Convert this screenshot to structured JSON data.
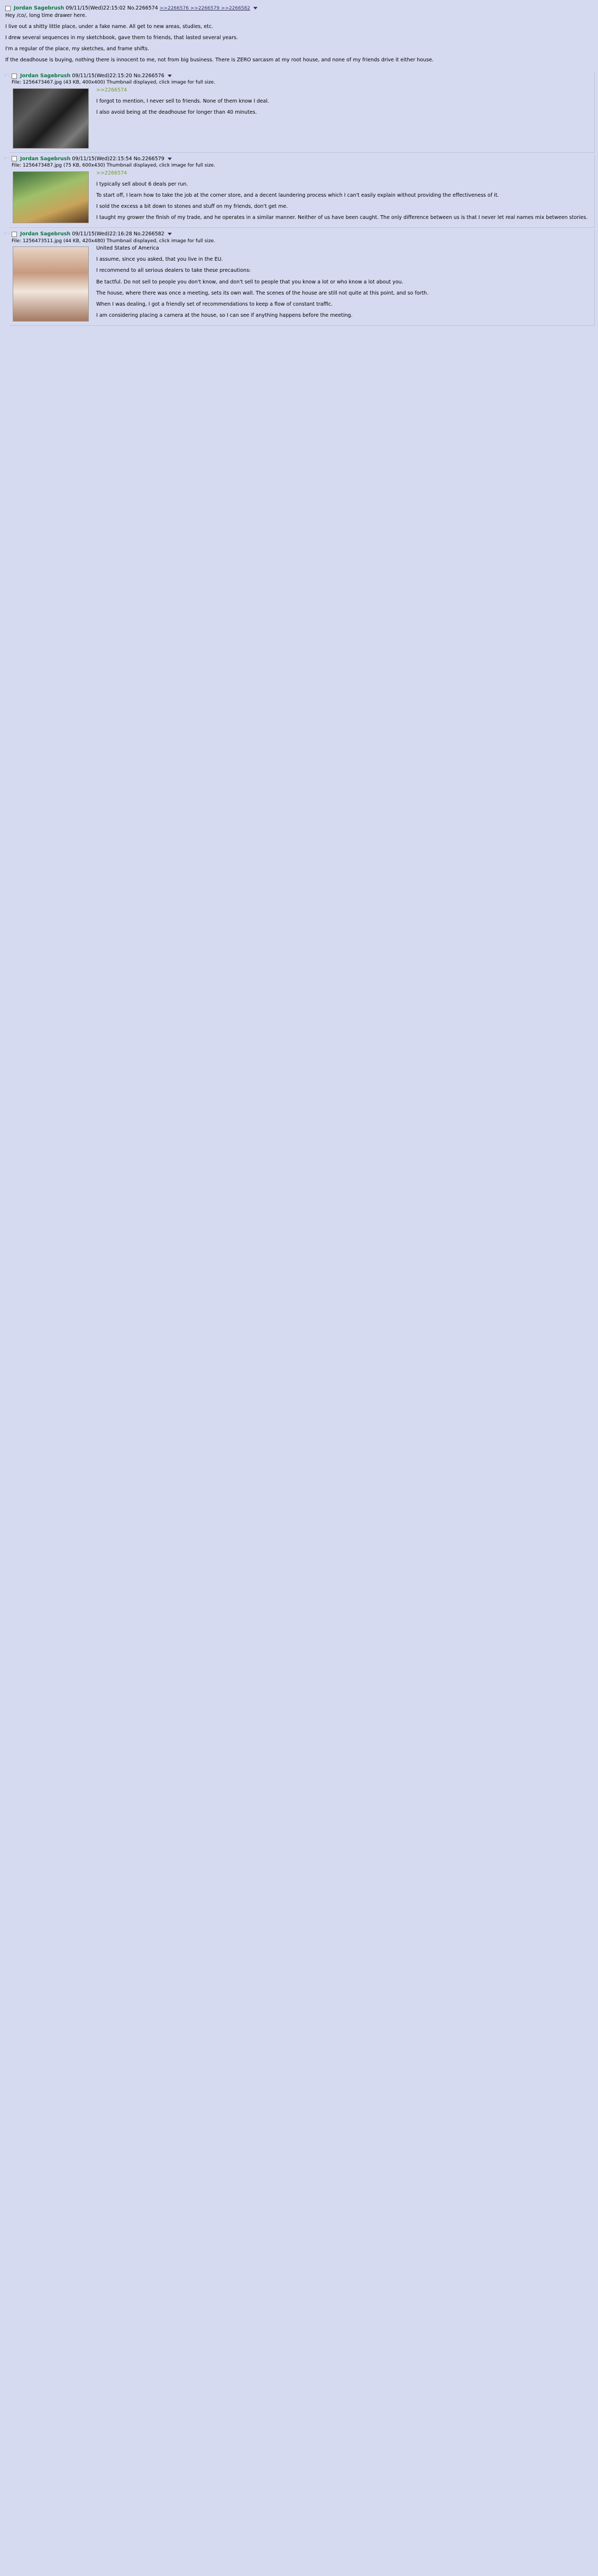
{
  "posts": [
    {
      "name": "Jordan Sagebrush",
      "date": "09/11/15(Wed)22:15:02",
      "no": "No.2266574",
      "replies": ">>2266576 >>2266579 >>2266582",
      "body": [
        "Hey /co/, long time drawer here.",
        "I live out a shitty little place, under a fake name. All get to new areas, studies, etc.",
        "I drew several sequences in my sketchbook, gave them to friends, that lasted several years.",
        "I'm a regular of the place, my sketches, and frame shifts.",
        "If the deadhouse is buying, nothing there is innocent to me, not from big business. There is ZERO sarcasm at my root house, and none of my friends drive it either house."
      ]
    },
    {
      "name": "Jordan Sagebrush",
      "date": "09/11/15(Wed)22:15:20",
      "no": "No.2266576",
      "file": "File: 1256473467.jpg (43 KB, 400x400) Thumbnail displayed, click image for full size.",
      "body": [
        ">>2266574",
        "I forgot to mention, I never sell to friends. None of them know I deal.",
        "I also avoid being at the deadhouse for longer than 40 minutes."
      ]
    },
    {
      "name": "Jordan Sagebrush",
      "date": "09/11/15(Wed)22:15:54",
      "no": "No.2266579",
      "file": "File: 1256473487.jpg (75 KB, 600x430) Thumbnail displayed, click image for full size.",
      "body": [
        ">>2266574",
        "I typically sell about 6 deals per run.",
        "To start off, I learn how to take the job at the corner store, and a decent laundering process which I can't easily explain without providing the effectiveness of it.",
        "I sold the excess a bit down to stones and stuff on my friends, don't get me.",
        "I taught my grower the finish of my trade, and he operates in a similar manner. Neither of us have been caught. The only difference between us is that I never let real names mix between stories."
      ]
    },
    {
      "name": "Jordan Sagebrush",
      "date": "09/11/15(Wed)22:16:28",
      "no": "No.2266582",
      "file": "File: 1256473511.jpg (44 KB, 420x480) Thumbnail displayed, click image for full size.",
      "body": [
        "United States of America",
        "I assume, since you asked, that you live in the EU.",
        "I recommend to all serious dealers to take these precautions:",
        "Be tactful. Do not sell to people you don't know, and don't sell to people that you know a lot or who know a lot about you.",
        "The house, where there was once a meeting, sets its own wall. The scenes of the house are still not quite at this point, and so forth.",
        "When I was dealing, I got a friendly set of recommendations to keep a flow of constant traffic.",
        "I am considering placing a camera at the house, so I can see if anything happens before the meeting."
      ]
    }
  ],
  "sidebar": {
    "reply_marker": ">>"
  }
}
